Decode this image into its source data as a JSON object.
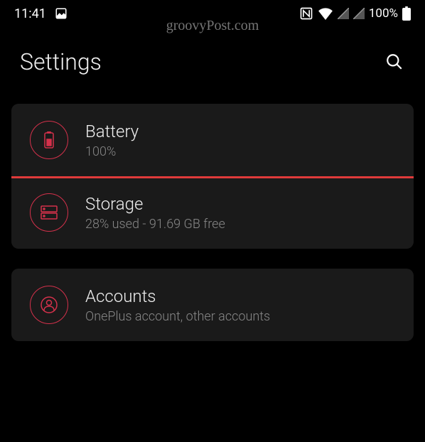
{
  "status_bar": {
    "time": "11:41",
    "battery_percent": "100%"
  },
  "watermark": "groovyPost.com",
  "header": {
    "title": "Settings"
  },
  "groups": [
    {
      "items": [
        {
          "title": "Battery",
          "subtitle": "100%",
          "highlighted": true
        },
        {
          "title": "Storage",
          "subtitle": "28% used - 91.69 GB free"
        }
      ]
    },
    {
      "items": [
        {
          "title": "Accounts",
          "subtitle": "OnePlus account, other accounts"
        }
      ]
    }
  ]
}
